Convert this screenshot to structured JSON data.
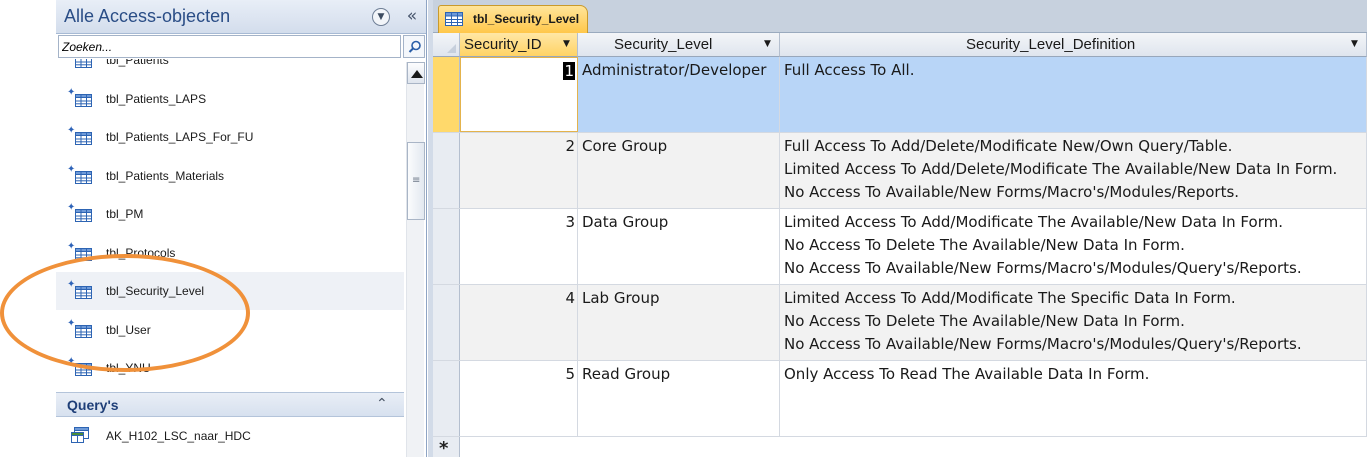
{
  "navigation_pane": {
    "title": "Alle Access-objecten",
    "menu_icon": "circle-chevron-down-icon",
    "collapse_icon": "double-chevron-left-icon",
    "search": {
      "value": "",
      "placeholder": "Zoeken..."
    },
    "tables": [
      {
        "label": "tbl_Patients",
        "new": false,
        "partial": true
      },
      {
        "label": "tbl_Patients_LAPS",
        "new": true
      },
      {
        "label": "tbl_Patients_LAPS_For_FU",
        "new": true
      },
      {
        "label": "tbl_Patients_Materials",
        "new": true
      },
      {
        "label": "tbl_PM",
        "new": true
      },
      {
        "label": "tbl_Protocols",
        "new": true,
        "partial": true
      },
      {
        "label": "tbl_Security_Level",
        "new": true,
        "selected": true
      },
      {
        "label": "tbl_User",
        "new": true
      },
      {
        "label": "tbl_YNU",
        "new": true
      }
    ],
    "query_group": {
      "label": "Query's",
      "expanded": true
    },
    "queries": [
      {
        "label": "AK_H102_LSC_naar_HDC"
      }
    ]
  },
  "document_tab": {
    "label": "tbl_Security_Level",
    "icon": "table-icon"
  },
  "grid": {
    "columns": [
      "Security_ID",
      "Security_Level",
      "Security_Level_Definition"
    ],
    "rows": [
      {
        "id": "1",
        "level": "Administrator/Developer",
        "definition": [
          "Full Access To All."
        ]
      },
      {
        "id": "2",
        "level": "Core Group",
        "definition": [
          "Full Access To Add/Delete/Modificate New/Own Query/Table.",
          "Limited Access To Add/Delete/Modificate The Available/New Data In Form.",
          "No Access To Available/New Forms/Macro's/Modules/Reports."
        ]
      },
      {
        "id": "3",
        "level": "Data Group",
        "definition": [
          "Limited Access To Add/Modificate The Available/New Data In Form.",
          "No Access To Delete The Available/New Data In Form.",
          "No Access To Available/New Forms/Macro's/Modules/Query's/Reports."
        ]
      },
      {
        "id": "4",
        "level": "Lab Group",
        "definition": [
          "Limited Access To Add/Modificate The Specific Data In Form.",
          "No Access To Delete The Available/New Data In Form.",
          "No Access To Available/New Forms/Macro's/Modules/Query's/Reports."
        ]
      },
      {
        "id": "5",
        "level": "Read Group",
        "definition": [
          "Only Access To Read The Available Data In Form."
        ]
      }
    ],
    "new_record_marker": "*"
  },
  "colors": {
    "highlight": "#f0913a",
    "selected_row": "#b8d5f7",
    "active_tab": "#ffc74a",
    "nav_title": "#2a4d86"
  }
}
